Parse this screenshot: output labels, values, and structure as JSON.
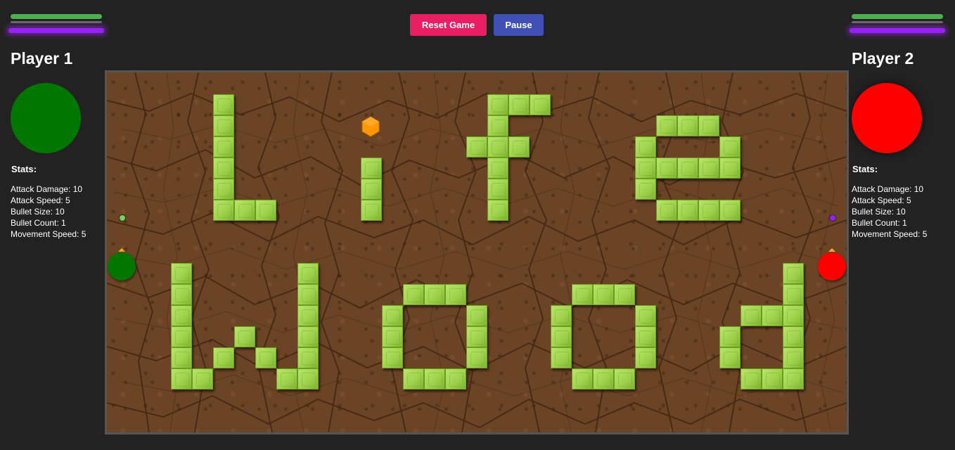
{
  "controls": {
    "reset_label": "Reset Game",
    "pause_label": "Pause"
  },
  "player1": {
    "name": "Player 1",
    "color": "#007700",
    "health_fraction": 1.0,
    "energy_fraction": 1.0,
    "stats_heading": "Stats:",
    "stats": [
      "Attack Damage: 10",
      "Attack Speed: 5",
      "Bullet Size: 10",
      "Bullet Count: 1",
      "Movement Speed: 5"
    ]
  },
  "player2": {
    "name": "Player 2",
    "color": "#ff0000",
    "health_fraction": 1.0,
    "energy_fraction": 1.0,
    "stats_heading": "Stats:",
    "stats": [
      "Attack Damage: 10",
      "Attack Speed: 5",
      "Bullet Size: 10",
      "Bullet Count: 1",
      "Movement Speed: 5"
    ]
  },
  "colors": {
    "health_bar": "#4caf50",
    "energy_bar": "#9b1eff",
    "wall_block": "#9fd34c",
    "power_up": "#ff9800",
    "bullet_p1": "#7ccf5a",
    "bullet_p2": "#9b1eff"
  },
  "icons": {
    "power_up": "orange-hexagon-icon",
    "wall": "green-block-icon"
  }
}
